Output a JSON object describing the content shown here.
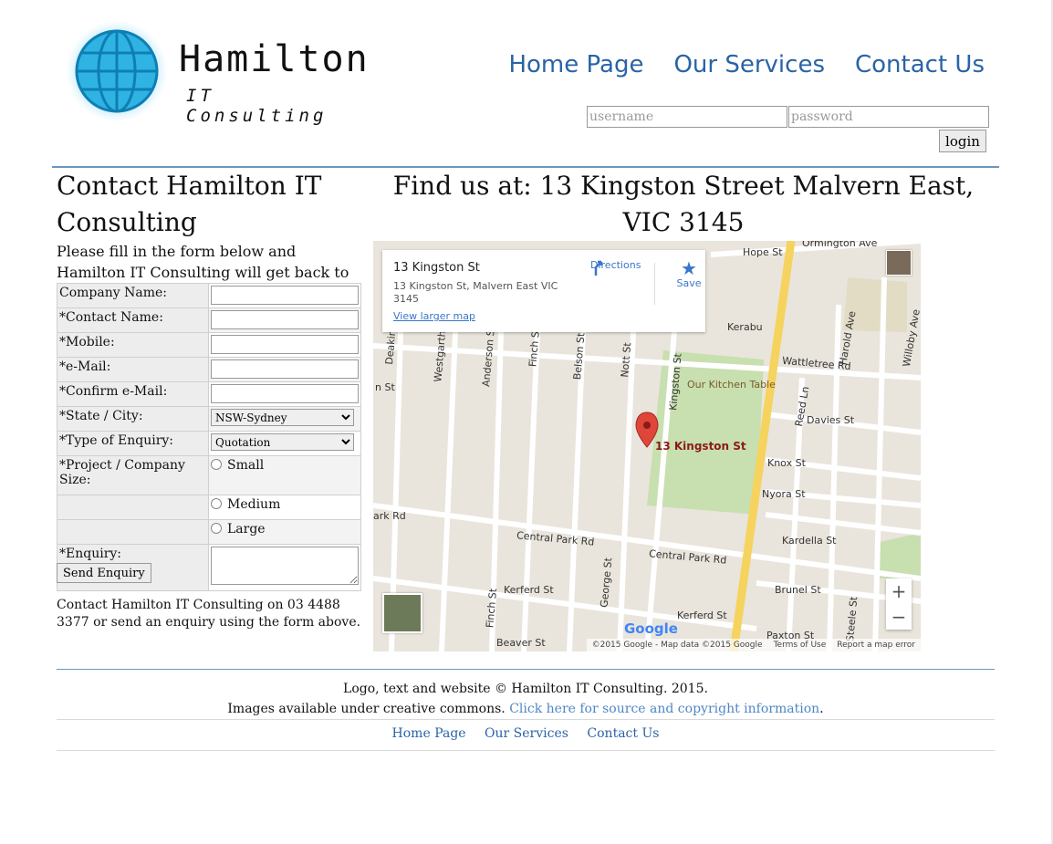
{
  "header": {
    "brand_name": "Hamilton",
    "brand_tagline": "IT Consulting",
    "nav": [
      "Home Page",
      "Our Services",
      "Contact Us"
    ],
    "login": {
      "username_placeholder": "username",
      "password_placeholder": "password",
      "button": "login"
    }
  },
  "contact": {
    "title": "Contact Hamilton IT Consulting",
    "intro": "Please fill in the form below and Hamilton IT Consulting will get back to you shortly.",
    "form": {
      "company_label": "Company Name:",
      "contact_label": "*Contact Name:",
      "mobile_label": "*Mobile:",
      "email_label": "*e-Mail:",
      "confirm_email_label": "*Confirm e-Mail:",
      "state_label": "*State / City:",
      "state_value": "NSW-Sydney",
      "enquiry_type_label": "*Type of Enquiry:",
      "enquiry_type_value": "Quotation",
      "size_label": "*Project / Company Size:",
      "size_options": [
        "Small",
        "Medium",
        "Large"
      ],
      "enquiry_label": "*Enquiry:",
      "send_button": "Send Enquiry"
    },
    "note": "Contact Hamilton IT Consulting on 03 4488 3377 or send an enquiry using the form above."
  },
  "location": {
    "title": "Find us at: 13 Kingston Street Malvern East, VIC 3145",
    "map": {
      "place_name": "13 Kingston St",
      "place_address": "13 Kingston St, Malvern East VIC 3145",
      "larger_map": "View larger map",
      "directions": "Directions",
      "save": "Save",
      "pin_label": "13 Kingston St",
      "google": "Google",
      "footer_copy": "©2015 Google - Map data ©2015 Google",
      "terms": "Terms of Use",
      "report": "Report a map error",
      "streets": [
        "Hope St",
        "Ormington Ave",
        "Kerabu",
        "Wattletree Rd",
        "Our Kitchen Table",
        "Davies St",
        "Knox St",
        "Nyora St",
        "Kardella St",
        "Central Park Rd",
        "Central Park Rd",
        "Kerferd St",
        "Kerferd St",
        "Brunel St",
        "Beaver St",
        "Paxton St",
        "Harold Ave",
        "Willoby Ave",
        "Reed Ln",
        "Kingston St",
        "Nott St",
        "Belson St",
        "Finch St",
        "Anderson St",
        "Westgarth",
        "George St",
        "Finch St",
        "Steele St",
        "Deakin",
        "ark Rd",
        "n St"
      ]
    }
  },
  "footer": {
    "copyright_line": "Logo, text and website © Hamilton IT Consulting. 2015.",
    "images_line_prefix": "Images available under creative commons. ",
    "images_link": "Click here for source and copyright information",
    "images_line_suffix": ".",
    "nav": [
      "Home Page",
      "Our Services",
      "Contact Us"
    ]
  }
}
